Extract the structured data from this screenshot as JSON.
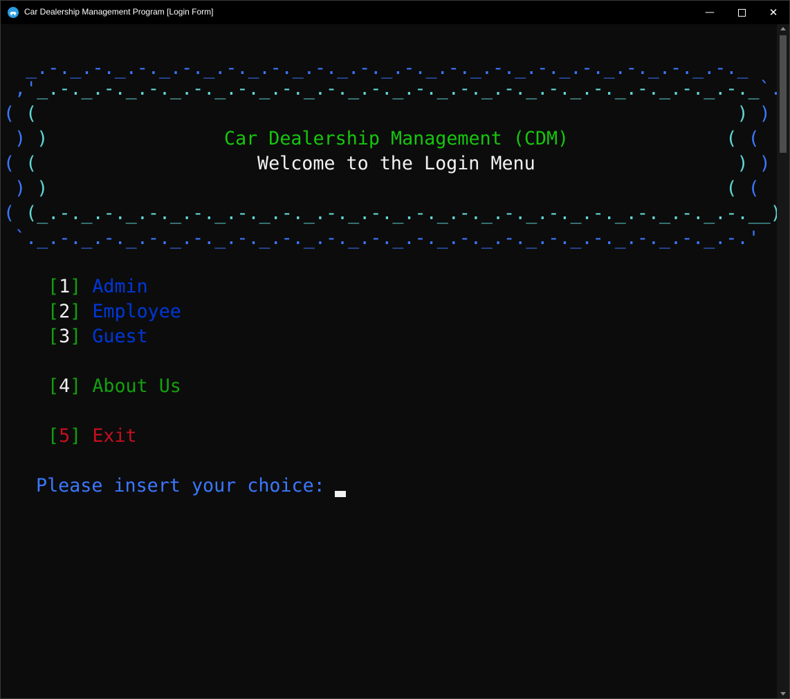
{
  "window": {
    "title": "Car Dealership Management Program [Login Form]",
    "icon": "app-icon",
    "controls": {
      "minimize": "—",
      "close": "✕"
    }
  },
  "banner": {
    "top1_prefix": "  _",
    "top1_body": ".-._.-._.-._.-._.-._.-._.-._.-._.-._.-._.-._.-._.-._.-._.-._.-._",
    "top2_prefix": " ,'",
    "top2_body": "_.-._.-._.-._.-._.-._.-._.-._.-._.-._.-._.-._.-._.-._.-._.-._.-._",
    "top2_suffix": "`.",
    "title": "Car Dealership Management (CDM)",
    "subtitle": "Welcome to the Login Menu",
    "bottom2_body": ".-._.-._.-._.-._.-._.-._.-._.-._.-._.-._.-._.-._.-._.-._.-._.-._",
    "bottom3_body": "._.-._.-._.-._.-._.-._.-._.-._.-._.-._.-._.-._.-._.-._.-._.-._.-.",
    "colors": {
      "outer": "#3b78ff",
      "inner": "#61d6d6",
      "title": "#16c60c",
      "subtitle": "#f2f2f2"
    }
  },
  "menu": {
    "items": [
      {
        "key": "1",
        "label": "Admin"
      },
      {
        "key": "2",
        "label": "Employee"
      },
      {
        "key": "3",
        "label": "Guest"
      },
      {
        "key": "4",
        "label": "About Us"
      },
      {
        "key": "5",
        "label": "Exit"
      }
    ],
    "colors": {
      "bracket": "#13a10e",
      "admin": "#0037da",
      "about": "#13a10e",
      "exit": "#c50f1f"
    }
  },
  "prompt": {
    "text": "Please insert your choice: "
  }
}
